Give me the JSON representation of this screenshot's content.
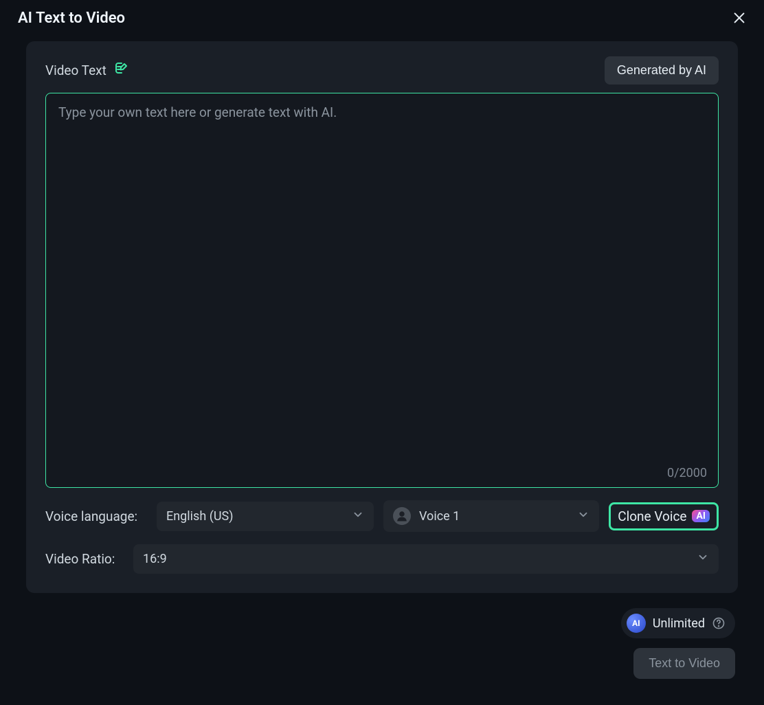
{
  "header": {
    "title": "AI Text to Video"
  },
  "videoText": {
    "label": "Video Text",
    "generatedBtn": "Generated by AI",
    "placeholder": "Type your own text here or generate text with AI.",
    "charCount": "0/2000"
  },
  "voice": {
    "label": "Voice language:",
    "langValue": "English (US)",
    "voiceValue": "Voice 1",
    "cloneLabel": "Clone Voice",
    "cloneBadge": "AI"
  },
  "ratio": {
    "label": "Video Ratio:",
    "value": "16:9"
  },
  "footer": {
    "unlimited": "Unlimited",
    "aiOrb": "AI",
    "ttvBtn": "Text to Video"
  }
}
